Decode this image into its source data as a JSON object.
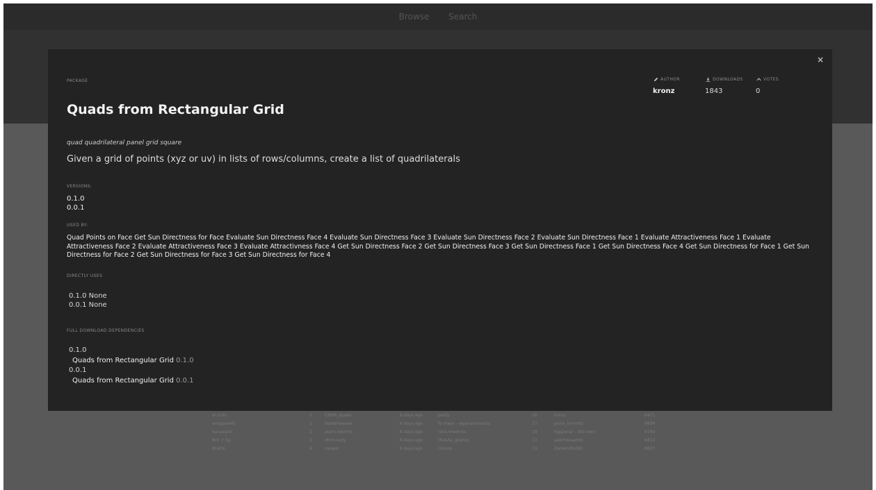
{
  "nav": {
    "browse_label": "Browse",
    "search_label": "Search"
  },
  "background_table": {
    "rows": [
      [
        "al.rinfo",
        "3",
        "CNNR_quadv",
        "6 days ago",
        "ponly",
        "16",
        "kronz",
        "9471"
      ],
      [
        "wrapparefy",
        "1",
        "bowwrwwww",
        "6 days ago",
        "fo mwor - wperamrwoxts",
        "37",
        "poria_wrmrmt",
        "9894"
      ],
      [
        "banaxaric",
        "2",
        "planv.swvrrrs",
        "6 days ago",
        "rons.mwmms",
        "18",
        "Fappenar - dtv.rvwn",
        "9760"
      ],
      [
        "Bnt + Sg",
        "2",
        "dhmuuvty",
        "6 days ago",
        "thalvta_grahvy",
        "13",
        "aakmoxaatmt",
        "9822"
      ],
      [
        "drarte",
        "4",
        "naswsr",
        "6 days ago",
        "rnnsoo",
        "15",
        "Darwin/Dvtdk",
        "9837"
      ]
    ]
  },
  "modal": {
    "close_label": "×",
    "package_label": "PACKAGE",
    "title": "Quads from Rectangular Grid",
    "author": {
      "label": "AUTHOR",
      "value": "kronz"
    },
    "downloads": {
      "label": "DOWNLOADS",
      "value": "1843"
    },
    "votes": {
      "label": "VOTES",
      "value": "0"
    },
    "keywords": "quad quadrilateral panel grid square",
    "description": "Given a grid of points (xyz or uv) in lists of rows/columns, create a list of quadrilaterals",
    "versions_label": "VERSIONS:",
    "versions": [
      "0.1.0",
      "0.0.1"
    ],
    "used_by_label": "USED BY:",
    "used_by": "Quad Points on Face Get Sun Directness for Face Evaluate Sun Directness Face 4 Evaluate Sun Directness Face 3 Evaluate Sun Directness Face 2 Evaluate Sun Directness Face 1 Evaluate Attractiveness Face 1 Evaluate Attractiveness Face 2 Evaluate Attractiveness Face 3 Evaluate Attractivness Face 4 Get Sun Directness Face 2 Get Sun Directness Face 3 Get Sun Directness Face 1 Get Sun Directness Face 4 Get Sun Directness for Face 1 Get Sun Directness for Face 2 Get Sun Directness for Face 3 Get Sun Directness for Face 4",
    "directly_uses_label": "DIRECTLY USES",
    "directly_uses": [
      "0.1.0 None",
      "0.0.1 None"
    ],
    "full_deps_label": "FULL DOWNLOAD DEPENDENCIES",
    "full_deps": [
      {
        "version": "0.1.0",
        "package": "Quads from Rectangular Grid",
        "package_version": "0.1.0"
      },
      {
        "version": "0.0.1",
        "package": "Quads from Rectangular Grid",
        "package_version": "0.0.1"
      }
    ],
    "icons": {
      "author": "pencil-icon",
      "downloads": "download-icon",
      "votes": "chevron-up-icon"
    }
  }
}
